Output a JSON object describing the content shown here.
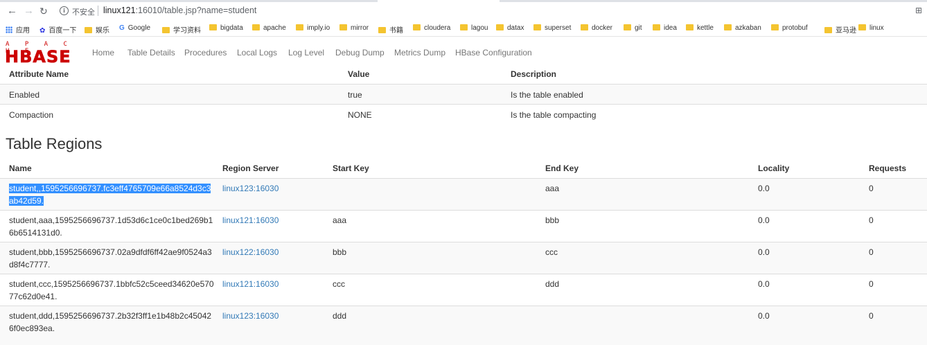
{
  "browser": {
    "security_label": "不安全",
    "url_host": "linux121",
    "url_rest": ":16010/table.jsp?name=student",
    "bookmarks": [
      {
        "label": "应用",
        "icon": "apps-icon"
      },
      {
        "label": "百度一下",
        "icon": "baidu-icon"
      },
      {
        "label": "娱乐",
        "icon": "folder-icon"
      },
      {
        "label": "Google",
        "icon": "google-icon"
      },
      {
        "label": "学习资料",
        "icon": "folder-icon"
      },
      {
        "label": "bigdata",
        "icon": "folder-icon"
      },
      {
        "label": "apache",
        "icon": "folder-icon"
      },
      {
        "label": "imply.io",
        "icon": "folder-icon"
      },
      {
        "label": "mirror",
        "icon": "folder-icon"
      },
      {
        "label": "书籍",
        "icon": "folder-icon"
      },
      {
        "label": "cloudera",
        "icon": "folder-icon"
      },
      {
        "label": "lagou",
        "icon": "folder-icon"
      },
      {
        "label": "datax",
        "icon": "folder-icon"
      },
      {
        "label": "superset",
        "icon": "folder-icon"
      },
      {
        "label": "docker",
        "icon": "folder-icon"
      },
      {
        "label": "git",
        "icon": "folder-icon"
      },
      {
        "label": "idea",
        "icon": "folder-icon"
      },
      {
        "label": "kettle",
        "icon": "folder-icon"
      },
      {
        "label": "azkaban",
        "icon": "folder-icon"
      },
      {
        "label": "protobuf",
        "icon": "folder-icon"
      },
      {
        "label": "亚马逊",
        "icon": "folder-icon"
      },
      {
        "label": "linux",
        "icon": "folder-icon"
      }
    ]
  },
  "logo": {
    "top": "A P A C H E",
    "main": "HBASE"
  },
  "nav": [
    "Home",
    "Table Details",
    "Procedures",
    "Local Logs",
    "Log Level",
    "Debug Dump",
    "Metrics Dump",
    "HBase Configuration"
  ],
  "attributes": {
    "headers": [
      "Attribute Name",
      "Value",
      "Description"
    ],
    "rows": [
      [
        "Enabled",
        "true",
        "Is the table enabled"
      ],
      [
        "Compaction",
        "NONE",
        "Is the table compacting"
      ]
    ]
  },
  "regions": {
    "title": "Table Regions",
    "headers": [
      "Name",
      "Region Server",
      "Start Key",
      "End Key",
      "Locality",
      "Requests"
    ],
    "rows": [
      {
        "name": "student,,1595256696737.fc3eff4765709e66a8524d3c3ab42d59.",
        "server": "linux123:16030",
        "start": "",
        "end": "aaa",
        "locality": "0.0",
        "requests": "0"
      },
      {
        "name": "student,aaa,1595256696737.1d53d6c1ce0c1bed269b16b6514131d0.",
        "server": "linux121:16030",
        "start": "aaa",
        "end": "bbb",
        "locality": "0.0",
        "requests": "0"
      },
      {
        "name": "student,bbb,1595256696737.02a9dfdf6ff42ae9f0524a3d8f4c7777.",
        "server": "linux122:16030",
        "start": "bbb",
        "end": "ccc",
        "locality": "0.0",
        "requests": "0"
      },
      {
        "name": "student,ccc,1595256696737.1bbfc52c5ceed34620e57077c62d0e41.",
        "server": "linux121:16030",
        "start": "ccc",
        "end": "ddd",
        "locality": "0.0",
        "requests": "0"
      },
      {
        "name": "student,ddd,1595256696737.2b32f3ff1e1b48b2c450426f0ec893ea.",
        "server": "linux123:16030",
        "start": "ddd",
        "end": "",
        "locality": "0.0",
        "requests": "0"
      }
    ]
  }
}
